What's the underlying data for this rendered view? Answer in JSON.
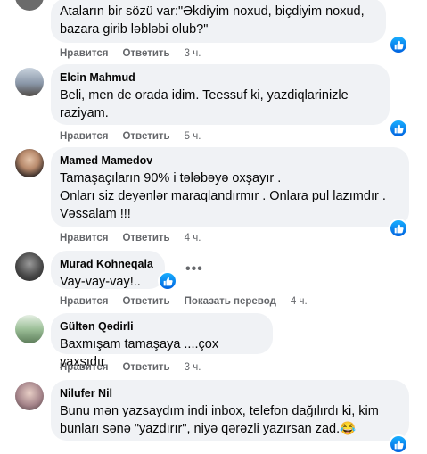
{
  "labels": {
    "like": "Нравится",
    "reply": "Ответить",
    "see_translation": "Показать перевод"
  },
  "comments": [
    {
      "author": "",
      "text": "Ataların bir sözü var:\"Əkdiyim noxud, biçdiyim noxud,\nbazara girib ləbləbi olub?\"",
      "time": "3 ч.",
      "avatar_color": "#6b6b6b"
    },
    {
      "author": "Elcin Mahmud",
      "text": "Beli, men de orada idim. Teessuf ki, yazdiqlarinizle\nraziyam.",
      "time": "5 ч.",
      "avatar_color": "#8a97a8"
    },
    {
      "author": "Mamed Mamedov",
      "text": "Tamaşaçıların 90% i tələbəyə oxşayır .\nOnları siz deyənlər maraqlandırmır . Onlara pul lazımdır .\nVəssalam !!!",
      "time": "4 ч.",
      "avatar_color": "#7a5a4a"
    },
    {
      "author": "Murad Kohneqala",
      "text": "Vay-vay-vay!..",
      "time": "4 ч.",
      "avatar_color": "#3d3d3d"
    },
    {
      "author": "Gültən Qədirli",
      "text": "Baxmışam tamaşaya ....çox yaxşıdır",
      "time": "3 ч.",
      "avatar_color": "#7ea07a"
    },
    {
      "author": "Nilufer Nil",
      "text": "Bunu mən yazsaydım indi inbox, telefon dağılırdı ki, kim\nbunları sənə \"yazdırır\", niyə qərəzli yazırsan zad.😂",
      "time": "",
      "avatar_color": "#a5848a"
    }
  ],
  "colors": {
    "bubble": "#f0f2f5",
    "muted": "#65676b",
    "like_blue": "#1877f2"
  }
}
